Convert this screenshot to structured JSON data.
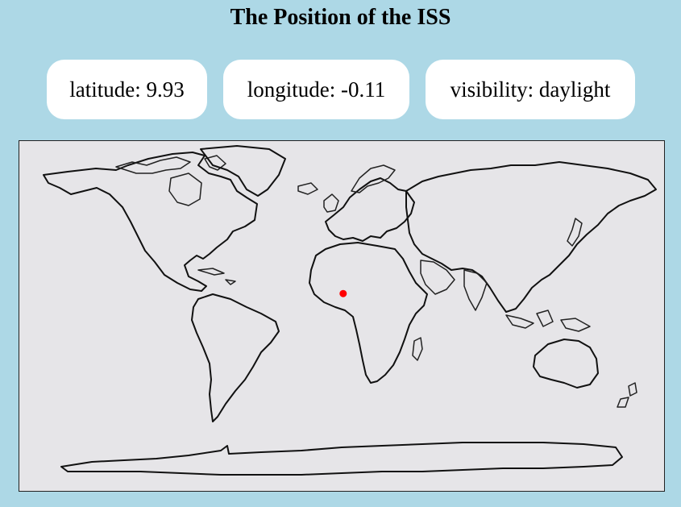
{
  "page": {
    "title": "The Position of the ISS"
  },
  "iss": {
    "latitude_text": "latitude: 9.93",
    "longitude_text": "longitude: -0.11",
    "visibility_text": "visibility: daylight",
    "latitude": 9.93,
    "longitude": -0.11,
    "marker_color": "#ff0000"
  },
  "colors": {
    "background": "#add8e6",
    "card": "#ffffff",
    "map_paper": "#e6e5e8",
    "outline": "#111111"
  }
}
